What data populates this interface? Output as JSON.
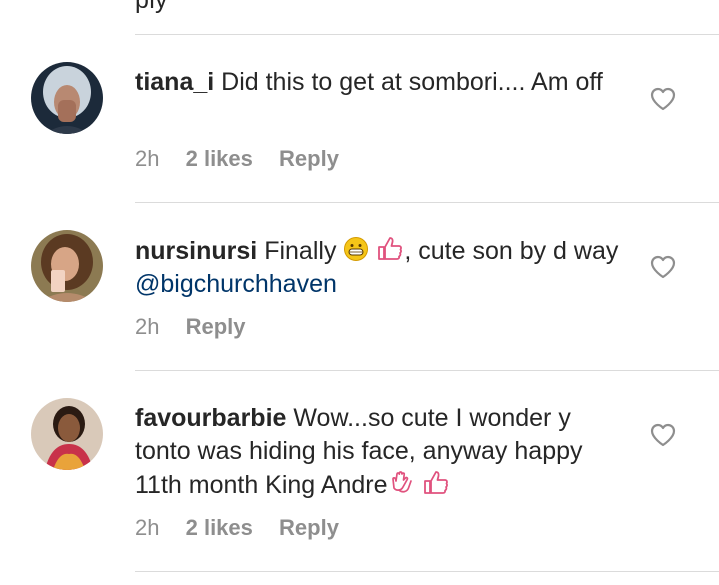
{
  "top_fragment": "ply",
  "comments": [
    {
      "username": "tiana_i",
      "text": "Did this to get at sombori.... Am off",
      "time": "2h",
      "likes": "2 likes",
      "reply": "Reply"
    },
    {
      "username": "nursinursi",
      "text_before": "Finally",
      "text_after": ", cute son by d way",
      "mention": "@bigchurchhaven",
      "time": "2h",
      "reply": "Reply"
    },
    {
      "username": "favourbarbie",
      "text": "Wow...so cute I wonder y tonto was hiding his face, anyway happy 11th month King Andre",
      "time": "2h",
      "likes": "2 likes",
      "reply": "Reply"
    }
  ],
  "icons": {
    "like": "heart-outline-icon",
    "grin": "grinning-face-icon",
    "thumbs": "thumbs-up-icon",
    "clap": "clapping-hands-icon"
  },
  "colors": {
    "text": "#262626",
    "secondary": "#8e8e8e",
    "mention": "#003569",
    "divider": "#dbdbdb",
    "emoji_pink": "#e0527e",
    "emoji_yellow": "#f5c518"
  }
}
